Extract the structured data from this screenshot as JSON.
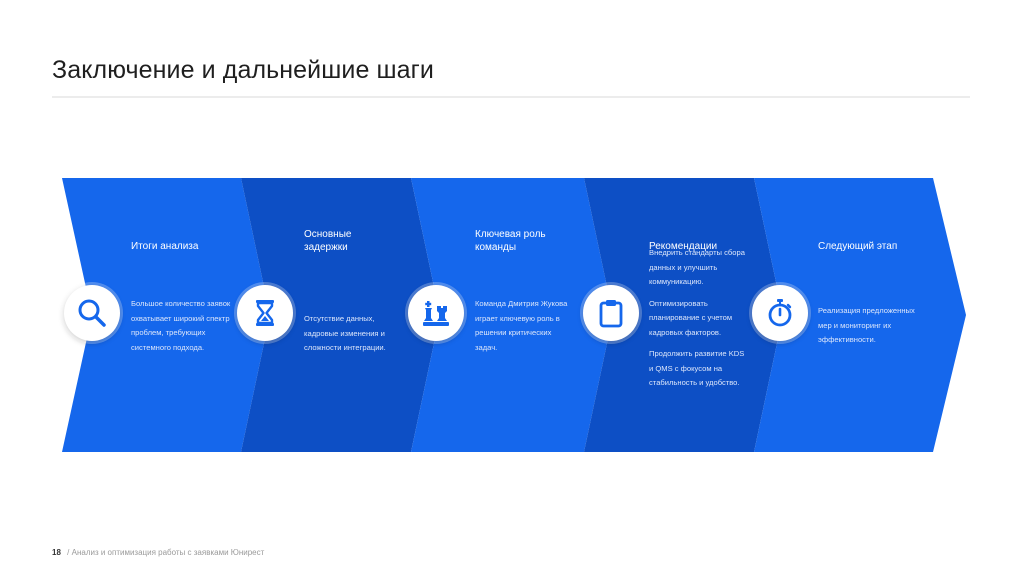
{
  "page": {
    "title": "Заключение и дальнейшие шаги",
    "footer_number": "18",
    "footer_separator": "/",
    "footer_text": "Анализ и оптимизация работы с заявками Юнирест"
  },
  "colors": {
    "chevron_light": "#1567ec",
    "chevron_dark": "#0d4fc5",
    "icon_blue": "#1567ec"
  },
  "steps": [
    {
      "title": "Итоги анализа",
      "icon": "search-icon",
      "paragraphs": [
        "Большое количество заявок охватывает широкий спектр проблем, требующих системного подхода."
      ]
    },
    {
      "title": "Основные задержки",
      "icon": "hourglass-icon",
      "paragraphs": [
        "Отсутствие данных, кадровые изменения и сложности интеграции."
      ]
    },
    {
      "title": "Ключевая роль команды",
      "icon": "chess-icon",
      "paragraphs": [
        "Команда Дмитрия Жукова играет ключевую роль в решении критических задач."
      ]
    },
    {
      "title": "Рекомендации",
      "icon": "clipboard-icon",
      "paragraphs": [
        "Внедрить стандарты сбора данных и улучшить коммуникацию.",
        "Оптимизировать планирование с учетом кадровых факторов.",
        "Продолжить развитие KDS и QMS с фокусом на стабильность и удобство."
      ]
    },
    {
      "title": "Следующий этап",
      "icon": "stopwatch-icon",
      "paragraphs": [
        "Реализация предложенных мер и мониторинг их эффективности."
      ]
    }
  ]
}
